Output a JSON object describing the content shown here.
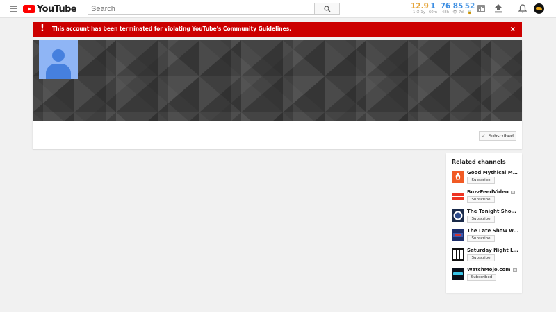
{
  "header": {
    "logo_text": "YouTube",
    "search_placeholder": "Search",
    "stats": [
      {
        "value": "12.9",
        "sub": "1 ⏱ 1y"
      },
      {
        "value": "1",
        "sub": "60m"
      },
      {
        "value": "76",
        "sub": "48h"
      },
      {
        "value": "85",
        "sub": "👁 7d"
      },
      {
        "value": "52",
        "sub": "🔒"
      }
    ],
    "icons": [
      "menu-icon",
      "search-icon",
      "analytics-icon",
      "upload-icon",
      "bell-icon"
    ]
  },
  "alert": {
    "icon": "!",
    "message": "This account has been terminated for violating YouTube's Community Guidelines.",
    "close": "×",
    "color": "#cc0000"
  },
  "channel": {
    "subscribed_label": "Subscribed"
  },
  "related": {
    "title": "Related channels",
    "items": [
      {
        "name": "Good Mythical Morn…",
        "subscribe": "Subscribe",
        "verified": false
      },
      {
        "name": "BuzzFeedVideo",
        "subscribe": "Subscribe",
        "verified": true,
        "thumb_text": "BuzzFeed VIDEO"
      },
      {
        "name": "The Tonight Show S…",
        "subscribe": "Subscribe",
        "verified": false
      },
      {
        "name": "The Late Show with …",
        "subscribe": "Subscribe",
        "verified": false
      },
      {
        "name": "Saturday Night Live",
        "subscribe": "Subscribe",
        "verified": true,
        "thumb_text": "SNL"
      },
      {
        "name": "WatchMojo.com",
        "subscribe": "Subscribed",
        "verified": true,
        "thumb_text": "mojo"
      }
    ]
  },
  "colors": {
    "accent_red": "#ff0000",
    "stat_orange": "#e5a53a",
    "stat_blue": "#3d8ee2"
  }
}
